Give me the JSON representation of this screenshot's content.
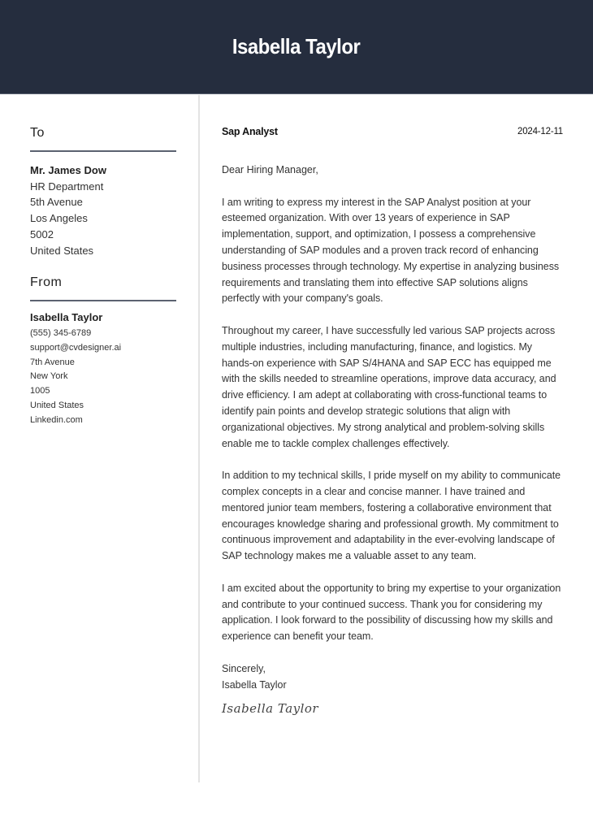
{
  "header": {
    "name": "Isabella Taylor"
  },
  "recipient": {
    "heading": "To",
    "name": "Mr. James Dow",
    "lines": [
      "HR Department",
      "5th Avenue",
      "Los Angeles",
      "5002",
      "United States"
    ]
  },
  "sender": {
    "heading": "From",
    "name": "Isabella Taylor",
    "phone": "(555) 345-6789",
    "email": "support@cvdesigner.ai",
    "street": "7th Avenue",
    "city": "New York",
    "zip": "1005",
    "country": "United States",
    "website": "Linkedin.com"
  },
  "letter": {
    "job_title": "Sap Analyst",
    "date": "2024-12-11",
    "salutation": "Dear Hiring Manager,",
    "paragraphs": [
      "I am writing to express my interest in the SAP Analyst position at your esteemed organization. With over 13 years of experience in SAP implementation, support, and optimization, I possess a comprehensive understanding of SAP modules and a proven track record of enhancing business processes through technology. My expertise in analyzing business requirements and translating them into effective SAP solutions aligns perfectly with your company's goals.",
      "Throughout my career, I have successfully led various SAP projects across multiple industries, including manufacturing, finance, and logistics. My hands-on experience with SAP S/4HANA and SAP ECC has equipped me with the skills needed to streamline operations, improve data accuracy, and drive efficiency. I am adept at collaborating with cross-functional teams to identify pain points and develop strategic solutions that align with organizational objectives. My strong analytical and problem-solving skills enable me to tackle complex challenges effectively.",
      "In addition to my technical skills, I pride myself on my ability to communicate complex concepts in a clear and concise manner. I have trained and mentored junior team members, fostering a collaborative environment that encourages knowledge sharing and professional growth. My commitment to continuous improvement and adaptability in the ever-evolving landscape of SAP technology makes me a valuable asset to any team.",
      "I am excited about the opportunity to bring my expertise to your organization and contribute to your continued success. Thank you for considering my application. I look forward to the possibility of discussing how my skills and experience can benefit your team."
    ],
    "closing": "Sincerely,",
    "signer": "Isabella Taylor",
    "signature": "Isabella Taylor"
  },
  "colors": {
    "header_bg": "#252d3e",
    "header_text": "#ffffff",
    "rule": "#5b6270",
    "divider": "#e3e3e3"
  }
}
